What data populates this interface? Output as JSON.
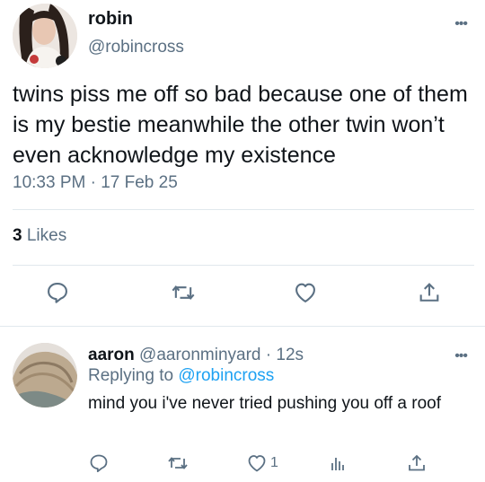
{
  "main_tweet": {
    "display_name": "robin",
    "handle": "@robincross",
    "text": "twins piss me off so bad because one of them is my bestie meanwhile the other twin won’t even acknowledge my existence",
    "timestamp": "10:33 PM · 17 Feb 25",
    "likes_count": "3",
    "likes_label": "Likes",
    "actions": [
      "reply-icon",
      "retweet-icon",
      "like-icon",
      "share-icon"
    ]
  },
  "reply_tweet": {
    "display_name": "aaron",
    "meta": "@aaronminyard · 12s",
    "replying_prefix": "Replying to",
    "replying_to": "@robincross",
    "text": "mind you i've never tried pushing you off a roof",
    "like_count": "1",
    "actions": [
      "reply-icon",
      "retweet-icon",
      "like-icon",
      "analytics-icon",
      "share-icon"
    ]
  },
  "colors": {
    "text": "#0f1419",
    "secondary": "#5b7083",
    "accent": "#1da1f2",
    "divider": "#e1e8ed"
  }
}
